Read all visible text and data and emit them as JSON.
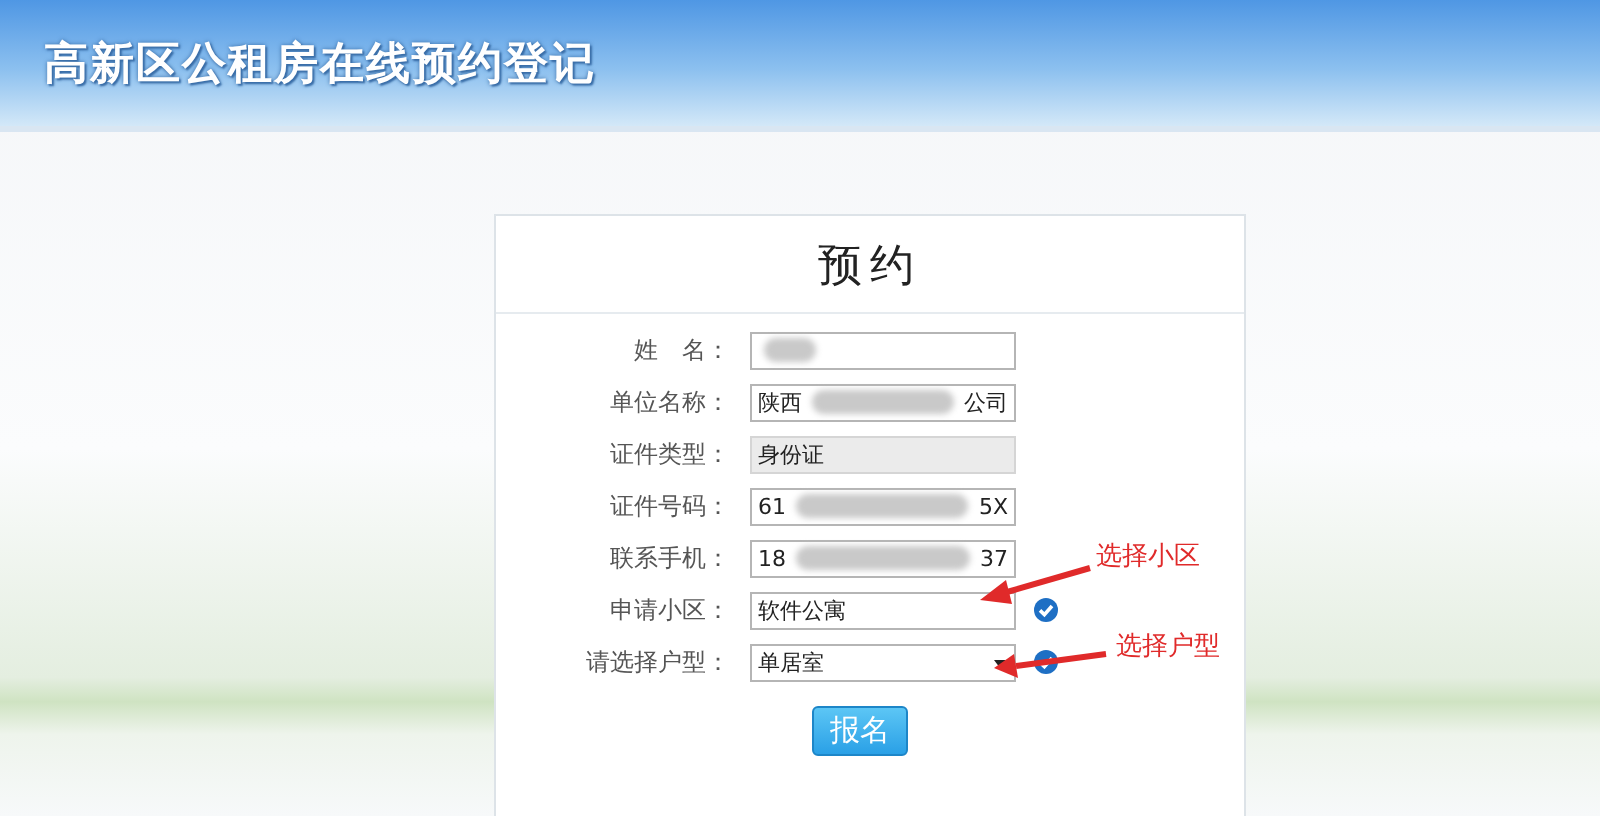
{
  "header": {
    "title": "高新区公租房在线预约登记"
  },
  "form": {
    "title": "预约",
    "fields": [
      {
        "label": "姓　名：",
        "kind": "text",
        "blurred": true
      },
      {
        "label": "单位名称：",
        "kind": "text",
        "blurred": true,
        "value_parts": [
          "陕西",
          "公司"
        ]
      },
      {
        "label": "证件类型：",
        "kind": "readonly",
        "value_parts": [
          "身份证"
        ]
      },
      {
        "label": "证件号码：",
        "kind": "text",
        "blurred": true,
        "value_parts": [
          "61",
          "5X"
        ]
      },
      {
        "label": "联系手机：",
        "kind": "text",
        "blurred": true,
        "value_parts": [
          "18",
          "37"
        ]
      },
      {
        "label": "申请小区：",
        "kind": "text",
        "value_parts": [
          "软件公寓"
        ],
        "verified": true
      },
      {
        "label": "请选择户型：",
        "kind": "select",
        "value_parts": [
          "单居室"
        ],
        "verified": true
      }
    ],
    "submit": "报名"
  },
  "annotations": [
    {
      "text": "选择小区"
    },
    {
      "text": "选择户型"
    }
  ]
}
